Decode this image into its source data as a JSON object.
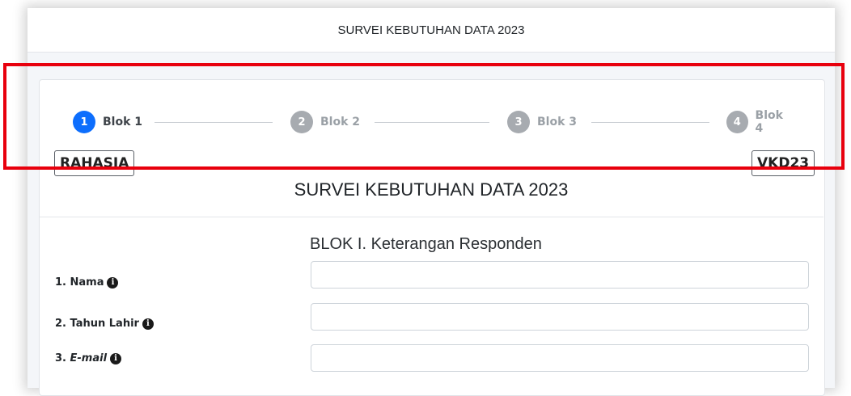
{
  "header": {
    "title": "SURVEI KEBUTUHAN DATA 2023"
  },
  "stepper": {
    "steps": [
      {
        "number": "1",
        "label": "Blok 1",
        "active": true
      },
      {
        "number": "2",
        "label": "Blok 2",
        "active": false
      },
      {
        "number": "3",
        "label": "Blok 3",
        "active": false
      },
      {
        "number": "4",
        "label": "Blok 4",
        "active": false
      }
    ]
  },
  "tags": {
    "left": "RAHASIA",
    "right": "VKD23"
  },
  "form": {
    "title": "SURVEI KEBUTUHAN DATA 2023",
    "block_title": "BLOK I. Keterangan Responden",
    "fields": [
      {
        "label": "1. Nama",
        "value": "",
        "placeholder": ""
      },
      {
        "label": "2. Tahun Lahir",
        "value": "",
        "placeholder": ""
      },
      {
        "label_prefix": "3. ",
        "label_em": "E-mail",
        "value": "",
        "placeholder": ""
      }
    ]
  },
  "icons": {
    "info": "info-circle-icon"
  },
  "colors": {
    "active_step": "#0d6efd",
    "inactive_step": "#a7abb0",
    "highlight": "#e8000d"
  }
}
